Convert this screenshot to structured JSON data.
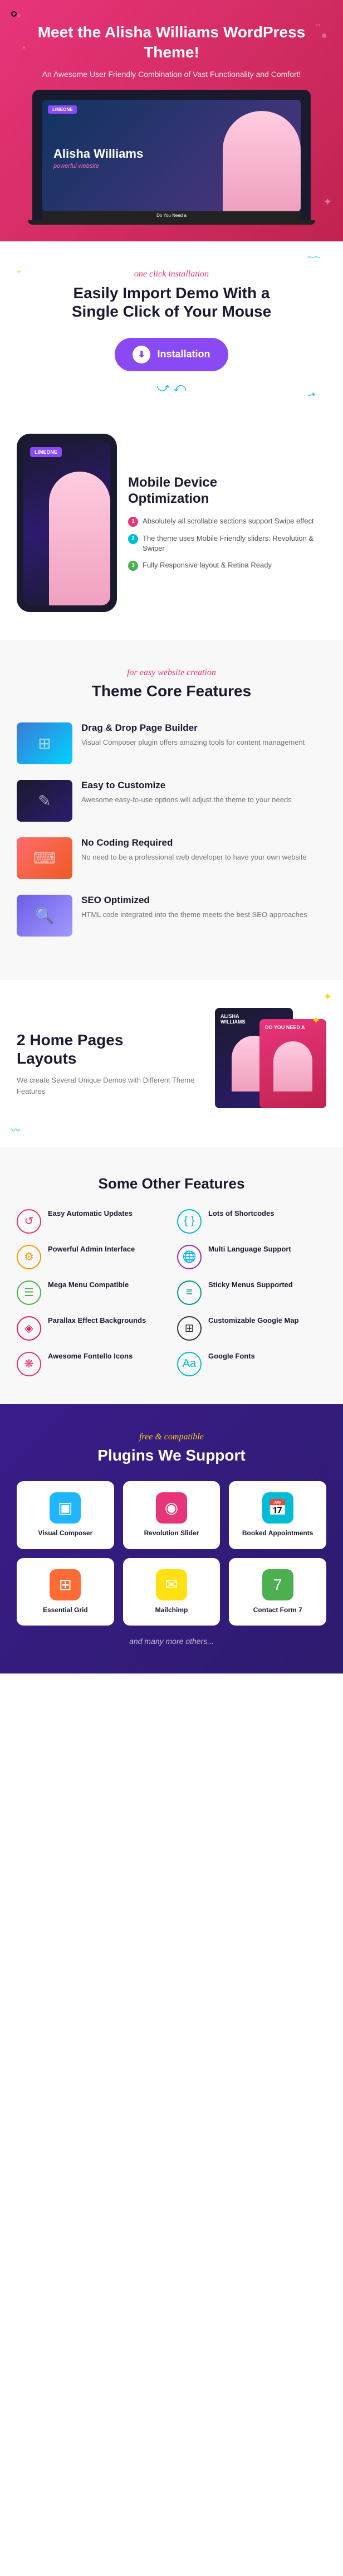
{
  "hero": {
    "title": "Meet the Alisha Williams WordPress Theme!",
    "subtitle": "An Awesome User Friendly Combination of Vast Functionality and Comfort!",
    "laptop_heading": "Alisha Williams",
    "laptop_tagline": "powerful website",
    "laptop_bar_text": "Do You Need a"
  },
  "installation": {
    "cursive": "one click installation",
    "heading_line1": "Easily Import Demo With a",
    "heading_line2": "Single Click of Your Mouse",
    "button_label": "Installation"
  },
  "mobile": {
    "title_line1": "Mobile Device",
    "title_line2": "Optimization",
    "feature1": "Absolutely all scrollable sections support Swipe effect",
    "feature2": "The theme uses Mobile Friendly sliders: Revolution & Swiper",
    "feature3": "Fully Responsive layout & Retina Ready",
    "logo_text": "LIMEONE"
  },
  "core_features": {
    "cursive": "for easy website creation",
    "heading": "Theme Core Features",
    "features": [
      {
        "title": "Drag & Drop Page Builder",
        "desc": "Visual Composer plugin offers amazing tools for content management",
        "thumb_class": "thumb-drag",
        "icon": "⊞"
      },
      {
        "title": "Easy to Customize",
        "desc": "Awesome easy-to-use options will adjust the theme to your needs",
        "thumb_class": "thumb-customize",
        "icon": "✎"
      },
      {
        "title": "No Coding Required",
        "desc": "No need to be a professional web developer to have your own website",
        "thumb_class": "thumb-coding",
        "icon": "⌨"
      },
      {
        "title": "SEO Optimized",
        "desc": "HTML code integrated into the theme meets the best SEO approaches",
        "thumb_class": "thumb-seo",
        "icon": "🔍"
      }
    ]
  },
  "layouts": {
    "heading_line1": "2 Home Pages",
    "heading_line2": "Layouts",
    "desc": "We create Several Unique Demos with Different Theme Features"
  },
  "other_features": {
    "heading": "Some Other Features",
    "items": [
      {
        "label": "Easy Automatic Updates",
        "icon": "↺",
        "icon_class": "red"
      },
      {
        "label": "Lots of Shortcodes",
        "icon": "{ }",
        "icon_class": "blue"
      },
      {
        "label": "Powerful Admin Interface",
        "icon": "⚙",
        "icon_class": "orange"
      },
      {
        "label": "Multi Language Support",
        "icon": "🌐",
        "icon_class": "purple"
      },
      {
        "label": "Mega Menu Compatible",
        "icon": "☰",
        "icon_class": "green"
      },
      {
        "label": "Sticky Menus Supported",
        "icon": "≡",
        "icon_class": "teal"
      },
      {
        "label": "Parallax Effect Backgrounds",
        "icon": "◈",
        "icon_class": "pink"
      },
      {
        "label": "Customizable Google Map",
        "icon": "⊞",
        "icon_class": "dark"
      },
      {
        "label": "Awesome Fontello Icons",
        "icon": "❋",
        "icon_class": "red"
      },
      {
        "label": "Google Fonts",
        "icon": "Aa",
        "icon_class": "blue"
      }
    ]
  },
  "plugins": {
    "cursive": "free & compatible",
    "heading": "Plugins We Support",
    "items": [
      {
        "label": "Visual Composer",
        "icon": "▣",
        "icon_class": "vc"
      },
      {
        "label": "Revolution Slider",
        "icon": "◉",
        "icon_class": "rev"
      },
      {
        "label": "Booked Appointments",
        "icon": "📅",
        "icon_class": "booked"
      },
      {
        "label": "Essential Grid",
        "icon": "⊞",
        "icon_class": "essential"
      },
      {
        "label": "Mailchimp",
        "icon": "✉",
        "icon_class": "mc"
      },
      {
        "label": "Contact Form 7",
        "icon": "7",
        "icon_class": "cf7"
      }
    ],
    "footer": "and many more others..."
  }
}
